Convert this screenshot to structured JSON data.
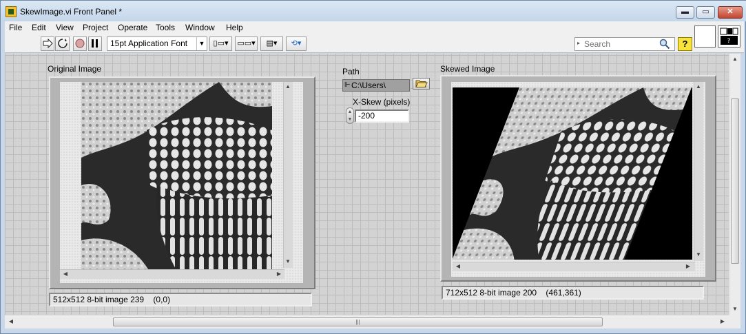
{
  "window": {
    "title": "SkewImage.vi Front Panel *",
    "controls": {
      "minimize": "▬",
      "maximize": "▭",
      "close": "✕"
    }
  },
  "menu": [
    "File",
    "Edit",
    "View",
    "Project",
    "Operate",
    "Tools",
    "Window",
    "Help"
  ],
  "toolbar": {
    "font_selector": "15pt Application Font",
    "search_placeholder": "Search",
    "help_label": "?",
    "icons": [
      "run-arrow-icon",
      "run-continuously-icon",
      "abort-icon",
      "pause-icon",
      "align-objects-icon",
      "distribute-objects-icon",
      "resize-objects-icon",
      "reorder-icon",
      "search-icon",
      "context-help-icon"
    ]
  },
  "panel": {
    "original_image": {
      "label": "Original Image",
      "info": "512x512 8-bit image 239    (0,0)"
    },
    "path": {
      "label": "Path",
      "value": "C:\\Users\\"
    },
    "x_skew": {
      "label": "X-Skew (pixels)",
      "value": "-200"
    },
    "skewed_image": {
      "label": "Skewed Image",
      "info": "712x512 8-bit image 200    (461,361)"
    }
  },
  "colors": {
    "panel_bg": "#d3d3d3",
    "grid": "#bcbcbc",
    "window_frame": "#c8d8ea",
    "help_button": "#f8e23c"
  }
}
